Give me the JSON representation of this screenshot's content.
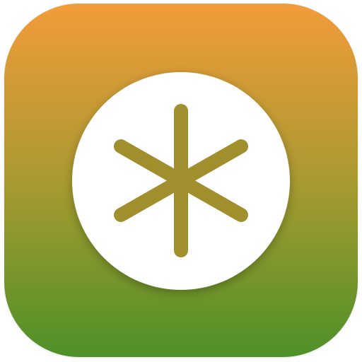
{
  "icon": {
    "symbol": "asterisk-icon",
    "gradient_top": "#F29B3A",
    "gradient_mid": "#A99A30",
    "gradient_bottom": "#4E9128",
    "disc_color": "#FFFFFF",
    "glyph_color": "#A18F2E"
  }
}
